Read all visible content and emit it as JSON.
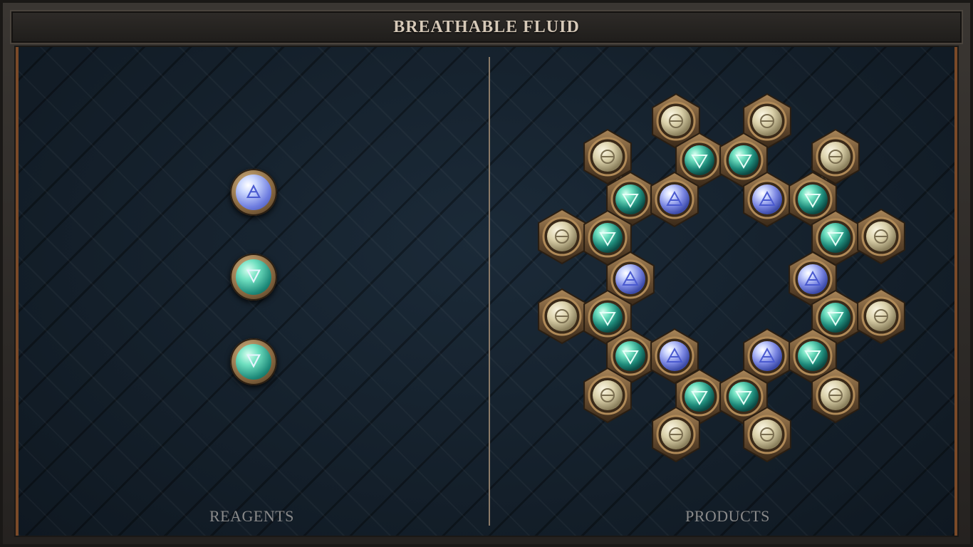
{
  "title": "BREATHABLE FLUID",
  "reagents_panel": {
    "label": "REAGENTS",
    "atoms": [
      {
        "element": "air",
        "symbol": "🜁"
      },
      {
        "element": "water",
        "symbol": "🜄"
      },
      {
        "element": "water",
        "symbol": "🜄"
      }
    ]
  },
  "products_panel": {
    "label": "PRODUCTS"
  },
  "colors": {
    "air": "#8a96f0",
    "water": "#3ec9a6",
    "salt": "#d8cfae",
    "frame_copper": "#7a4a28"
  }
}
